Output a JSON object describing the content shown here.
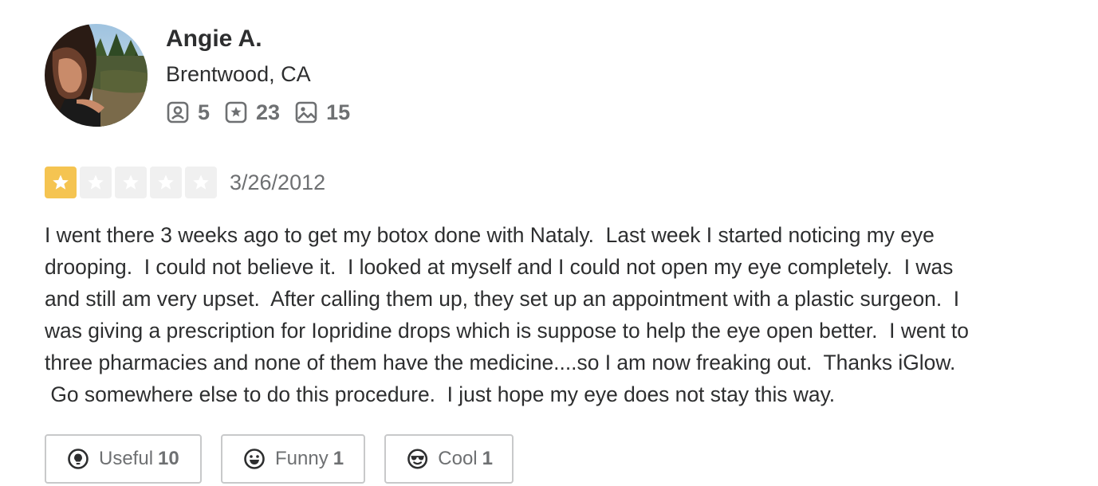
{
  "user": {
    "name": "Angie A.",
    "location": "Brentwood, CA",
    "stats": {
      "friends": "5",
      "reviews": "23",
      "photos": "15"
    }
  },
  "review": {
    "rating": 1,
    "max_rating": 5,
    "date": "3/26/2012",
    "text": "I went there 3 weeks ago to get my botox done with Nataly.  Last week I started noticing my eye\ndrooping.  I could not believe it.  I looked at myself and I could not open my eye completely.  I was\nand still am very upset.  After calling them up, they set up an appointment with a plastic surgeon.  I\nwas giving a prescription for Iopridine drops which is suppose to help the eye open better.  I went to\nthree pharmacies and none of them have the medicine....so I am now freaking out.  Thanks iGlow.\n Go somewhere else to do this procedure.  I just hope my eye does not stay this way."
  },
  "reactions": {
    "useful": {
      "label": "Useful",
      "count": "10",
      "icon": "lightbulb-icon"
    },
    "funny": {
      "label": "Funny",
      "count": "1",
      "icon": "grin-face-icon"
    },
    "cool": {
      "label": "Cool",
      "count": "1",
      "icon": "sunglasses-face-icon"
    }
  },
  "colors": {
    "star_filled": "#f5c451",
    "star_empty": "#f0f0f0",
    "text": "#2d2e2f",
    "muted": "#6e7072",
    "button_border": "#c8c9ca"
  }
}
